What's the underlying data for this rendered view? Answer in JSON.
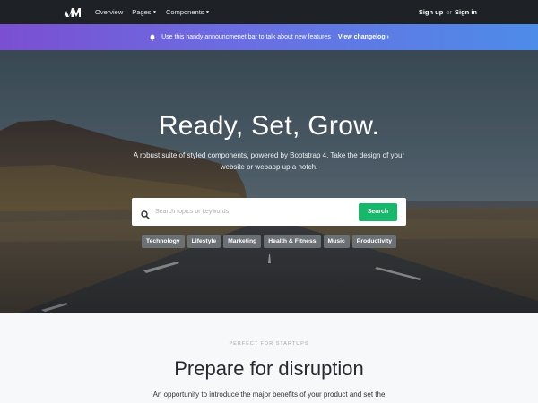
{
  "navbar": {
    "logo_text": "WM",
    "links": [
      {
        "label": "Overview",
        "has_caret": false
      },
      {
        "label": "Pages",
        "has_caret": true
      },
      {
        "label": "Components",
        "has_caret": true
      }
    ],
    "signup_label": "Sign up",
    "or_label": "or",
    "signin_label": "Sign in"
  },
  "announcement": {
    "text": "Use this handy announcmenet bar to talk about new features",
    "link_label": "View changelog ›",
    "icon": "bell-icon"
  },
  "hero": {
    "title": "Ready, Set, Grow.",
    "subtitle": "A robust suite of styled components, powered by Bootstrap 4. Take the design of your website or webapp up a notch.",
    "search": {
      "placeholder": "Search topics or keywords",
      "value": "",
      "button_label": "Search"
    },
    "tags": [
      "Technology",
      "Lifestyle",
      "Marketing",
      "Health & Fitness",
      "Music",
      "Productivity"
    ]
  },
  "section": {
    "eyebrow": "PERFECT FOR STARTUPS",
    "title": "Prepare for disruption",
    "text": "An opportunity to introduce the major benefits of your product and set the"
  },
  "colors": {
    "navbar_bg": "#1e2226",
    "announce_start": "#7b4fd1",
    "announce_end": "#4d8ce8",
    "search_button": "#17b86c",
    "tag_bg": "#6b7075"
  }
}
